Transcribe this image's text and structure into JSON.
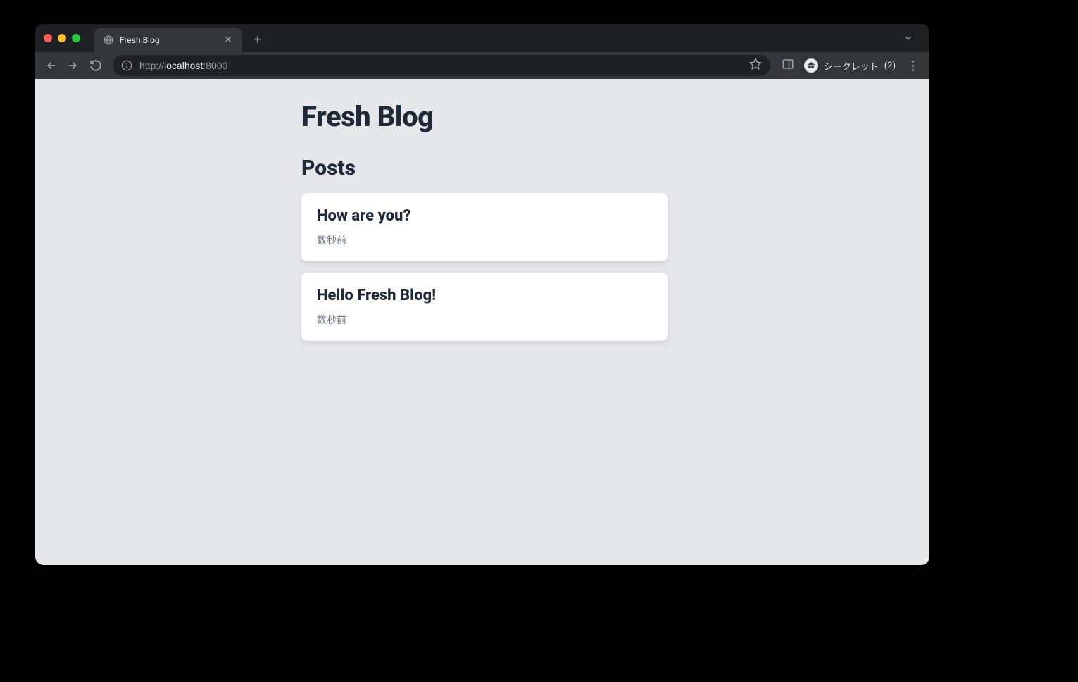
{
  "browser": {
    "tab": {
      "title": "Fresh Blog"
    },
    "url": {
      "protocol": "http://",
      "host": "localhost",
      "port": ":8000"
    },
    "incognito": {
      "label": "シークレット",
      "count": "(2)"
    }
  },
  "page": {
    "title": "Fresh Blog",
    "section": "Posts",
    "posts": [
      {
        "title": "How are you?",
        "time": "数秒前"
      },
      {
        "title": "Hello Fresh Blog!",
        "time": "数秒前"
      }
    ]
  }
}
